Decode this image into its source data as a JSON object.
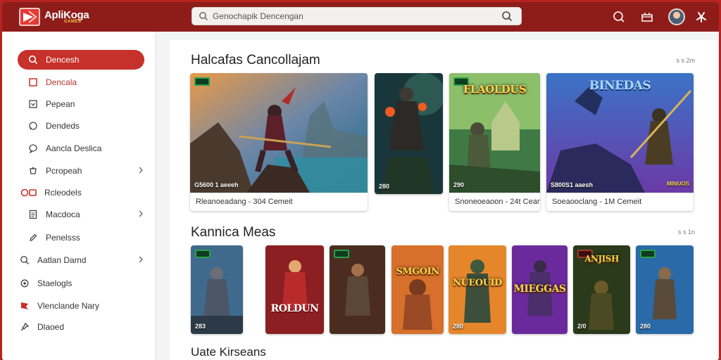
{
  "app": {
    "brand": "ApliKoga",
    "brand_sub": "GAMES"
  },
  "search": {
    "placeholder": "Genochapik Dencengan"
  },
  "sidebar": {
    "items": [
      {
        "label": "Dencesh",
        "icon": "search-icon",
        "active": true
      },
      {
        "label": "Dencala",
        "icon": "square-icon"
      },
      {
        "label": "Pepean",
        "icon": "download-box-icon"
      },
      {
        "label": "Dendeds",
        "icon": "chat-icon"
      },
      {
        "label": "Aancla Deslica",
        "icon": "chat-bubble-icon"
      },
      {
        "label": "Pcropeah",
        "icon": "cart-icon",
        "chevron": true
      },
      {
        "label": "Rcleodels",
        "icon": "record-icon"
      },
      {
        "label": "Macdoca",
        "icon": "document-icon",
        "chevron": true
      },
      {
        "label": "Penelsss",
        "icon": "edit-icon"
      },
      {
        "label": "Aatlan Damd",
        "icon": "search-icon",
        "chevron": true
      },
      {
        "label": "Staelogls",
        "icon": "settings-icon"
      },
      {
        "label": "Vlenclande Nary",
        "icon": "flag-icon"
      },
      {
        "label": "Dlaoed",
        "icon": "pin-icon"
      }
    ]
  },
  "sections": [
    {
      "title": "Halcafas Cancollajam",
      "meta": "ѕ s 2m"
    },
    {
      "title": "Kannica Meas",
      "meta": "ѕ s 1n"
    },
    {
      "title": "Uate Kirseans",
      "meta": ""
    }
  ],
  "featured": [
    {
      "caption": "Rleanoeadang - 304 Cemeit",
      "badge": "G5600 1 aeeeh"
    },
    {
      "caption": "",
      "badge": "280"
    },
    {
      "caption": "Snoneoeaoon - 24t Ceanat",
      "badge": "290",
      "art_title": "FLAOLDUS"
    },
    {
      "caption": "Soeaooclang - 1M Cemeit",
      "badge": "S800S1 aaesh",
      "art_title": "BINEDAS",
      "corner": "MINUOS"
    }
  ],
  "kanica": [
    {
      "badge": "283",
      "art_title": ""
    },
    {
      "badge": "",
      "art_title": "ROLDUN"
    },
    {
      "badge": "",
      "art_title": ""
    },
    {
      "badge": "",
      "art_title": "SMGOIN"
    },
    {
      "badge": "280",
      "art_title": "NUEOUID"
    },
    {
      "badge": "",
      "art_title": "MIEGGAS"
    },
    {
      "badge": "2/0",
      "art_title": "ANJISH"
    },
    {
      "badge": "280",
      "art_title": ""
    }
  ],
  "colors": {
    "accent": "#c7312b",
    "topbar": "#8e1d1a",
    "frame": "#b8231f"
  }
}
